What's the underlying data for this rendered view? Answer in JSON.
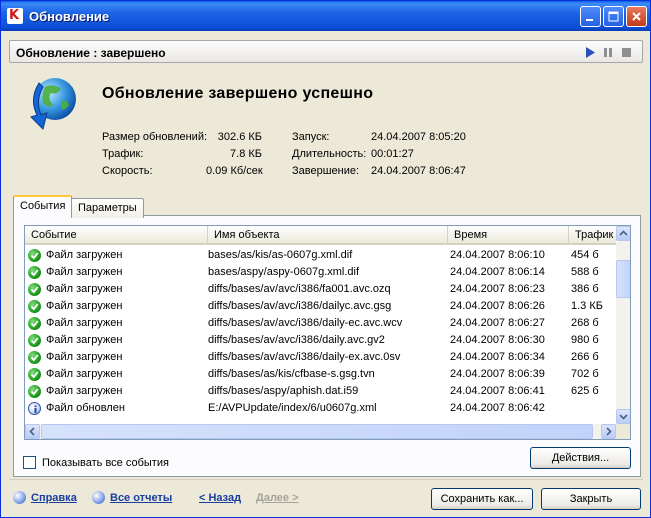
{
  "window": {
    "title": "Обновление",
    "colors": {
      "titlebar": "#0b4fd6",
      "close": "#c4391c",
      "ok": "#1e9a1e",
      "link": "#1a3ea0"
    }
  },
  "status": {
    "label": "Обновление : завершено"
  },
  "header": {
    "headline": "Обновление завершено успешно",
    "stats_left": [
      {
        "label": "Размер обновлений:",
        "value": "302.6 КБ"
      },
      {
        "label": "Трафик:",
        "value": "7.8 КБ"
      },
      {
        "label": "Скорость:",
        "value": "0.09 Кб/сек"
      }
    ],
    "stats_right": [
      {
        "label": "Запуск:",
        "value": "24.04.2007 8:05:20"
      },
      {
        "label": "Длительность:",
        "value": "00:01:27"
      },
      {
        "label": "Завершение:",
        "value": "24.04.2007 8:06:47"
      }
    ]
  },
  "tabs": [
    {
      "label": "События",
      "active": true
    },
    {
      "label": "Параметры",
      "active": false
    }
  ],
  "table": {
    "columns": [
      "Событие",
      "Имя объекта",
      "Время",
      "Трафик"
    ],
    "rows": [
      {
        "icon": "check-icon",
        "event": "Файл загружен",
        "object": "bases/as/kis/as-0607g.xml.dif",
        "time": "24.04.2007 8:06:10",
        "traffic": "454 б"
      },
      {
        "icon": "check-icon",
        "event": "Файл загружен",
        "object": "bases/aspy/aspy-0607g.xml.dif",
        "time": "24.04.2007 8:06:14",
        "traffic": "588 б"
      },
      {
        "icon": "check-icon",
        "event": "Файл загружен",
        "object": "diffs/bases/av/avc/i386/fa001.avc.ozq",
        "time": "24.04.2007 8:06:23",
        "traffic": "386 б"
      },
      {
        "icon": "check-icon",
        "event": "Файл загружен",
        "object": "diffs/bases/av/avc/i386/dailyc.avc.gsg",
        "time": "24.04.2007 8:06:26",
        "traffic": "1.3 КБ"
      },
      {
        "icon": "check-icon",
        "event": "Файл загружен",
        "object": "diffs/bases/av/avc/i386/daily-ec.avc.wcv",
        "time": "24.04.2007 8:06:27",
        "traffic": "268 б"
      },
      {
        "icon": "check-icon",
        "event": "Файл загружен",
        "object": "diffs/bases/av/avc/i386/daily.avc.gv2",
        "time": "24.04.2007 8:06:30",
        "traffic": "980 б"
      },
      {
        "icon": "check-icon",
        "event": "Файл загружен",
        "object": "diffs/bases/av/avc/i386/daily-ex.avc.0sv",
        "time": "24.04.2007 8:06:34",
        "traffic": "266 б"
      },
      {
        "icon": "check-icon",
        "event": "Файл загружен",
        "object": "diffs/bases/as/kis/cfbase-s.gsg.tvn",
        "time": "24.04.2007 8:06:39",
        "traffic": "702 б"
      },
      {
        "icon": "check-icon",
        "event": "Файл загружен",
        "object": "diffs/bases/aspy/aphish.dat.i59",
        "time": "24.04.2007 8:06:41",
        "traffic": "625 б"
      },
      {
        "icon": "info-icon",
        "event": "Файл обновлен",
        "object": "E:/AVPUpdate/index/6/u0607g.xml",
        "time": "24.04.2007 8:06:42",
        "traffic": ""
      }
    ]
  },
  "controls": {
    "show_all_label": "Показывать все события",
    "actions_label": "Действия...",
    "save_as_label": "Сохранить как...",
    "close_label": "Закрыть"
  },
  "links": {
    "help": "Справка",
    "all_reports": "Все отчеты",
    "back": "< Назад",
    "next": "Далее >"
  }
}
